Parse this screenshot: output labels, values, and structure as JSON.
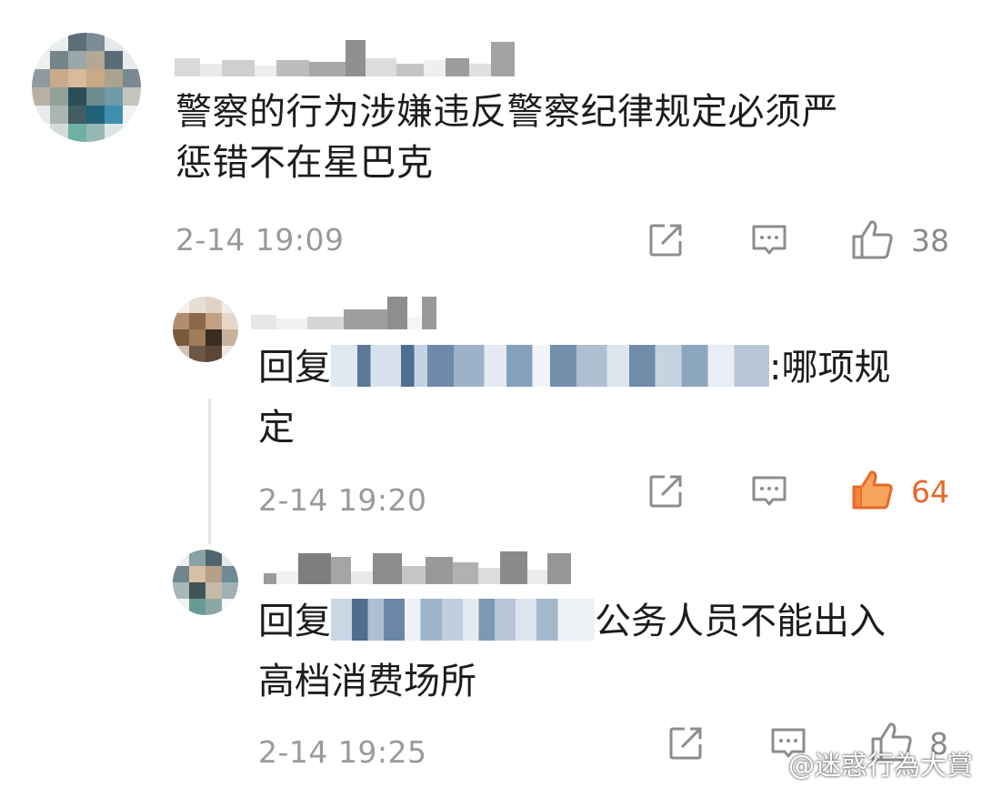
{
  "comments": [
    {
      "text_line1": "警察的行为涉嫌违反警察纪律规定必须严",
      "text_line2": "惩错不在星巴克",
      "time": "2-14 19:09",
      "likes": "38",
      "liked": false
    }
  ],
  "replies": [
    {
      "prefix": "回复",
      "suffix": ":哪项规",
      "line2": "定",
      "time": "2-14 19:20",
      "likes": "64",
      "liked": true
    },
    {
      "prefix": "回复",
      "suffix": "公务人员不能出入",
      "line2": "高档消费场所",
      "time": "2-14 19:25",
      "likes": "8",
      "liked": false
    }
  ],
  "icons": {
    "share": "share-icon",
    "comment": "comment-icon",
    "like": "thumbs-up-icon"
  },
  "colors": {
    "like_active": "#e8682a",
    "meta_gray": "#9a9a9a"
  },
  "watermark": "@迷惑行為大賞"
}
